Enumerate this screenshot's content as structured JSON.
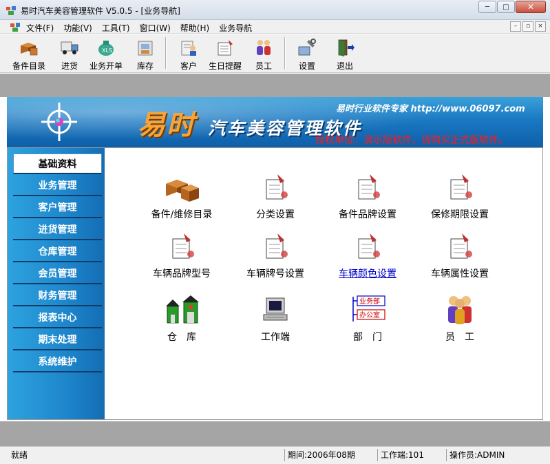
{
  "window": {
    "title": "易时汽车美容管理软件 V5.0.5 - [业务导航]",
    "minimize": "─",
    "maximize": "□",
    "close": "✕"
  },
  "menu": {
    "items": [
      "文件(F)",
      "功能(V)",
      "工具(T)",
      "窗口(W)",
      "帮助(H)",
      "业务导航"
    ],
    "mdi": [
      "–",
      "▫",
      "×"
    ]
  },
  "toolbar": {
    "buttons": [
      {
        "label": "备件目录",
        "icon": "boxes-icon"
      },
      {
        "label": "进货",
        "icon": "truck-icon"
      },
      {
        "label": "业务开单",
        "icon": "money-bag-icon"
      },
      {
        "label": "库存",
        "icon": "warehouse-icon"
      },
      {
        "label": "客户",
        "icon": "customer-icon"
      },
      {
        "label": "生日提醒",
        "icon": "birthday-icon"
      },
      {
        "label": "员工",
        "icon": "staff-icon"
      },
      {
        "label": "设置",
        "icon": "settings-icon"
      },
      {
        "label": "退出",
        "icon": "exit-icon"
      }
    ]
  },
  "banner": {
    "brand_main": "易时",
    "brand_sub": "汽车美容管理软件",
    "slogan": "易时行业软件专家 http://www.06097.com",
    "license": "授权单位：演示版软件，请购买正式版软件。"
  },
  "sidebar": {
    "items": [
      "基础资料",
      "业务管理",
      "客户管理",
      "进货管理",
      "仓库管理",
      "会员管理",
      "财务管理",
      "报表中心",
      "期末处理",
      "系统维护"
    ],
    "active_index": 0
  },
  "grid": {
    "items": [
      {
        "label": "备件/维修目录",
        "icon": "boxes-icon"
      },
      {
        "label": "分类设置",
        "icon": "register-icon"
      },
      {
        "label": "备件品牌设置",
        "icon": "register-icon"
      },
      {
        "label": "保修期限设置",
        "icon": "register-icon"
      },
      {
        "label": "车辆品牌型号",
        "icon": "register-icon"
      },
      {
        "label": "车辆牌号设置",
        "icon": "register-icon"
      },
      {
        "label": "车辆颜色设置",
        "icon": "register-icon"
      },
      {
        "label": "车辆属性设置",
        "icon": "register-icon"
      },
      {
        "label": "仓　库",
        "icon": "warehouse-icon"
      },
      {
        "label": "工作端",
        "icon": "computer-icon"
      },
      {
        "label": "部　门",
        "icon": "department-icon"
      },
      {
        "label": "员　工",
        "icon": "staff-icon"
      }
    ],
    "dept_labels": [
      "业务部",
      "办公室"
    ],
    "hovered_index": 6
  },
  "status": {
    "ready": "就绪",
    "period": "期间:2006年08期",
    "terminal": "工作端:101",
    "operator": "操作员:ADMIN"
  },
  "colors": {
    "sidebar": "#1e86cc",
    "banner": "#1a78c2",
    "license_text": "#ff1a1a",
    "link": "#0000cc"
  }
}
